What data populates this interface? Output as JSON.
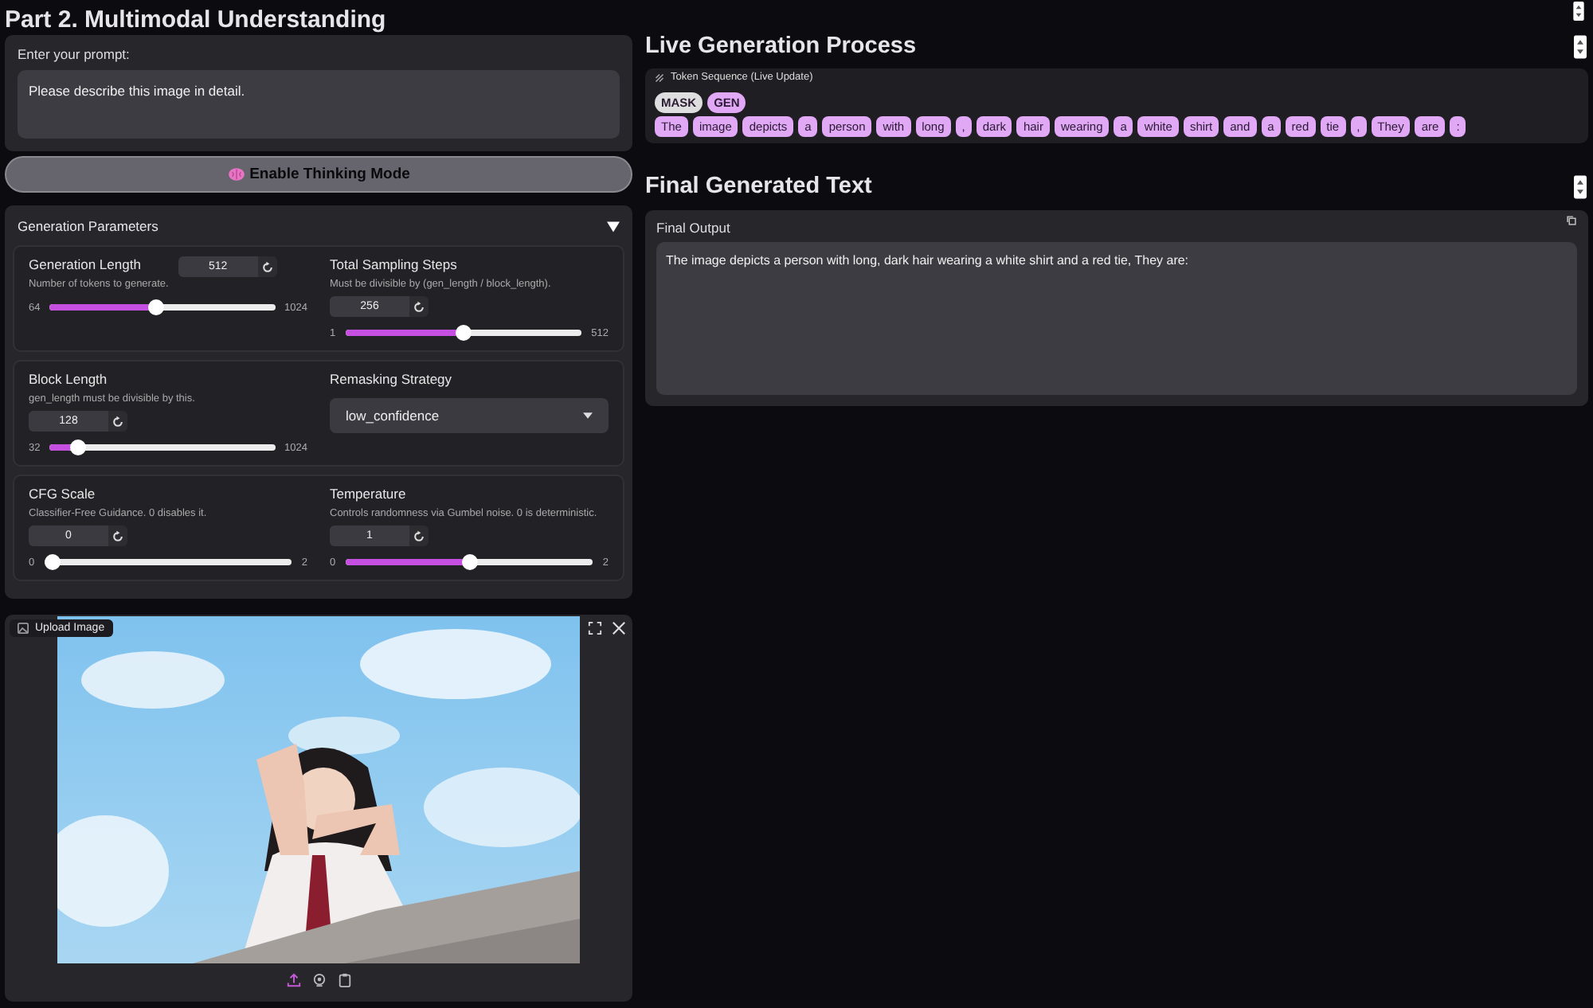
{
  "title": "Part 2. Multimodal Understanding",
  "prompt": {
    "label": "Enter your prompt:",
    "value": "Please describe this image in detail."
  },
  "thinking_button": {
    "label": "Enable Thinking Mode"
  },
  "parameters": {
    "title": "Generation Parameters",
    "expanded": true,
    "groups": [
      {
        "items": [
          {
            "kind": "slider",
            "label": "Generation Length",
            "description": "Number of tokens to generate.",
            "value": "512",
            "min": "64",
            "max": "1024",
            "level": 0.467,
            "field_inline": true
          },
          {
            "kind": "slider",
            "label": "Total Sampling Steps",
            "description": "Must be divisible by (gen_length / block_length).",
            "value": "256",
            "min": "1",
            "max": "512",
            "level": 0.5,
            "field_inline": false
          }
        ]
      },
      {
        "items": [
          {
            "kind": "slider",
            "label": "Block Length",
            "description": "gen_length must be divisible by this.",
            "value": "128",
            "min": "32",
            "max": "1024",
            "level": 0.097,
            "field_inline": false
          },
          {
            "kind": "dropdown",
            "label": "Remasking Strategy",
            "value": "low_confidence"
          }
        ]
      },
      {
        "items": [
          {
            "kind": "slider",
            "label": "CFG Scale",
            "description": "Classifier-Free Guidance. 0 disables it.",
            "value": "0",
            "min": "0",
            "max": "2",
            "level": 0,
            "field_inline": false
          },
          {
            "kind": "slider",
            "label": "Temperature",
            "description": "Controls randomness via Gumbel noise. 0 is deterministic.",
            "value": "1",
            "min": "0",
            "max": "2",
            "level": 0.5,
            "field_inline": false
          }
        ]
      }
    ]
  },
  "image_upload": {
    "label": "Upload Image"
  },
  "live": {
    "title": "Live Generation Process",
    "label": "Token Sequence (Live Update)",
    "legend": [
      {
        "text": "MASK",
        "kind": "mask"
      },
      {
        "text": "GEN",
        "kind": "gen"
      }
    ],
    "tokens": [
      {
        "text": "The",
        "kind": "gen"
      },
      {
        "text": "image",
        "kind": "gen"
      },
      {
        "text": "depicts",
        "kind": "gen"
      },
      {
        "text": "a",
        "kind": "gen"
      },
      {
        "text": "person",
        "kind": "gen"
      },
      {
        "text": "with",
        "kind": "gen"
      },
      {
        "text": "long",
        "kind": "gen"
      },
      {
        "text": ",",
        "kind": "gen"
      },
      {
        "text": "dark",
        "kind": "gen"
      },
      {
        "text": "hair",
        "kind": "gen"
      },
      {
        "text": "wearing",
        "kind": "gen"
      },
      {
        "text": "a",
        "kind": "gen"
      },
      {
        "text": "white",
        "kind": "gen"
      },
      {
        "text": "shirt",
        "kind": "gen"
      },
      {
        "text": "and",
        "kind": "gen"
      },
      {
        "text": "a",
        "kind": "gen"
      },
      {
        "text": "red",
        "kind": "gen"
      },
      {
        "text": "tie",
        "kind": "gen"
      },
      {
        "text": ",",
        "kind": "gen"
      },
      {
        "text": "They",
        "kind": "gen"
      },
      {
        "text": "are",
        "kind": "gen"
      },
      {
        "text": ":",
        "kind": "gen"
      }
    ]
  },
  "final": {
    "title": "Final Generated Text",
    "label": "Final Output",
    "value": "The image depicts a person with long, dark hair wearing a white shirt and a red tie, They are:"
  }
}
